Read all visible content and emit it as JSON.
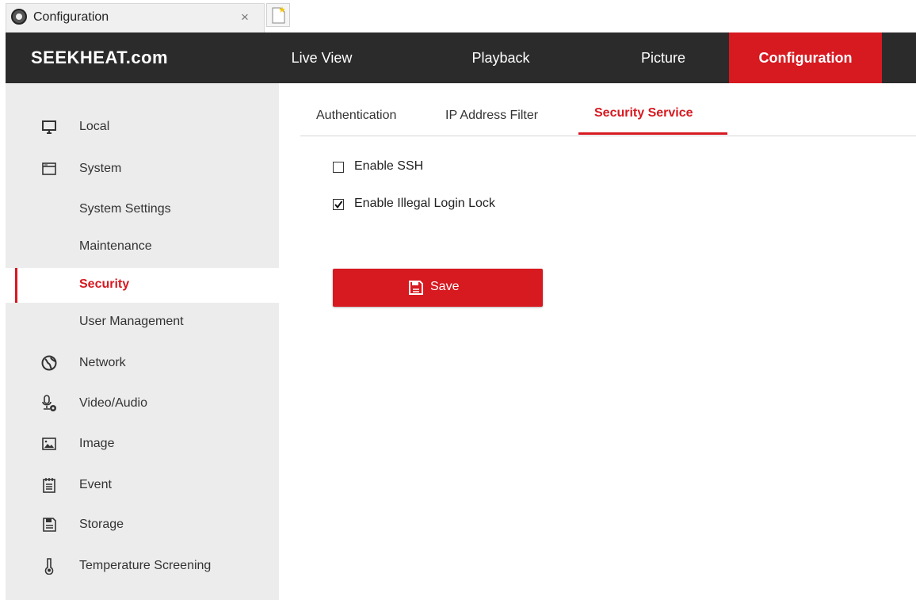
{
  "browser": {
    "tab_title": "Configuration",
    "tab_close": "×",
    "favicon_icon": "camera-icon",
    "new_tab_icon": "new-tab-icon"
  },
  "header": {
    "logo": "SEEKHEAT.com",
    "nav": [
      {
        "label": "Live View"
      },
      {
        "label": "Playback"
      },
      {
        "label": "Picture"
      },
      {
        "label": "Configuration",
        "active": true
      }
    ]
  },
  "sidebar": {
    "items": [
      {
        "label": "Local",
        "icon": "monitor-icon"
      },
      {
        "label": "System",
        "icon": "window-icon"
      },
      {
        "label": "System Settings"
      },
      {
        "label": "Maintenance"
      },
      {
        "label": "Security",
        "active": true
      },
      {
        "label": "User Management"
      },
      {
        "label": "Network",
        "icon": "globe-icon"
      },
      {
        "label": "Video/Audio",
        "icon": "microphone-icon"
      },
      {
        "label": "Image",
        "icon": "image-icon"
      },
      {
        "label": "Event",
        "icon": "calendar-icon"
      },
      {
        "label": "Storage",
        "icon": "floppy-icon"
      },
      {
        "label": "Temperature Screening",
        "icon": "thermometer-icon"
      }
    ]
  },
  "main": {
    "tabs": [
      {
        "label": "Authentication"
      },
      {
        "label": "IP Address Filter"
      },
      {
        "label": "Security Service",
        "active": true
      }
    ],
    "options": [
      {
        "label": "Enable SSH",
        "checked": false
      },
      {
        "label": "Enable Illegal Login Lock",
        "checked": true
      }
    ],
    "save_label": "Save"
  },
  "colors": {
    "accent": "#d71920",
    "topbar": "#2b2b2b",
    "sidebar": "#ececec"
  }
}
